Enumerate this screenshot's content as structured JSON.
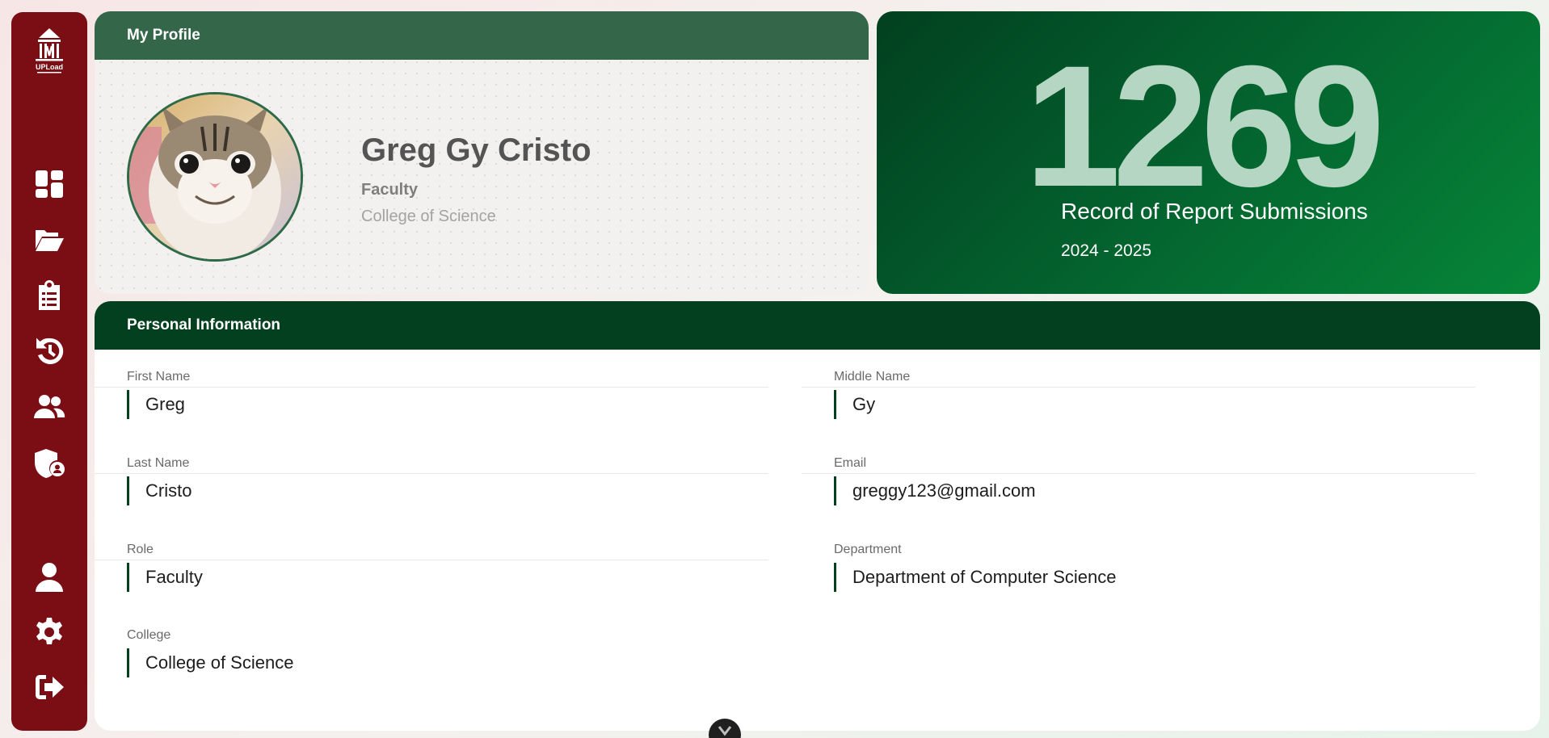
{
  "colors": {
    "sidebar_bg": "#7a0e14",
    "profile_header": "#346649",
    "info_header": "#03401f",
    "stat_number": "#b5d6c3"
  },
  "sidebar": {
    "logo_text": "UPLoad",
    "nav_items": [
      {
        "icon": "dashboard-icon"
      },
      {
        "icon": "folder-open-icon"
      },
      {
        "icon": "clipboard-list-icon"
      },
      {
        "icon": "history-icon"
      },
      {
        "icon": "users-icon"
      },
      {
        "icon": "shield-user-icon"
      },
      {
        "icon": "user-icon"
      },
      {
        "icon": "gear-icon"
      },
      {
        "icon": "logout-icon"
      }
    ]
  },
  "profile": {
    "header": "My Profile",
    "name": "Greg Gy Cristo",
    "role": "Faculty",
    "college": "College of Science",
    "avatar_alt": "cat-avatar"
  },
  "stats": {
    "count": "1269",
    "label": "Record of Report Submissions",
    "year": "2024 - 2025"
  },
  "personal_info": {
    "header": "Personal Information",
    "fields": [
      {
        "label": "First Name",
        "value": "Greg"
      },
      {
        "label": "Middle Name",
        "value": "Gy"
      },
      {
        "label": "Last Name",
        "value": "Cristo"
      },
      {
        "label": "Email",
        "value": "greggy123@gmail.com"
      },
      {
        "label": "Role",
        "value": "Faculty"
      },
      {
        "label": "Department",
        "value": "Department of Computer Science"
      },
      {
        "label": "College",
        "value": "College of Science"
      }
    ]
  }
}
